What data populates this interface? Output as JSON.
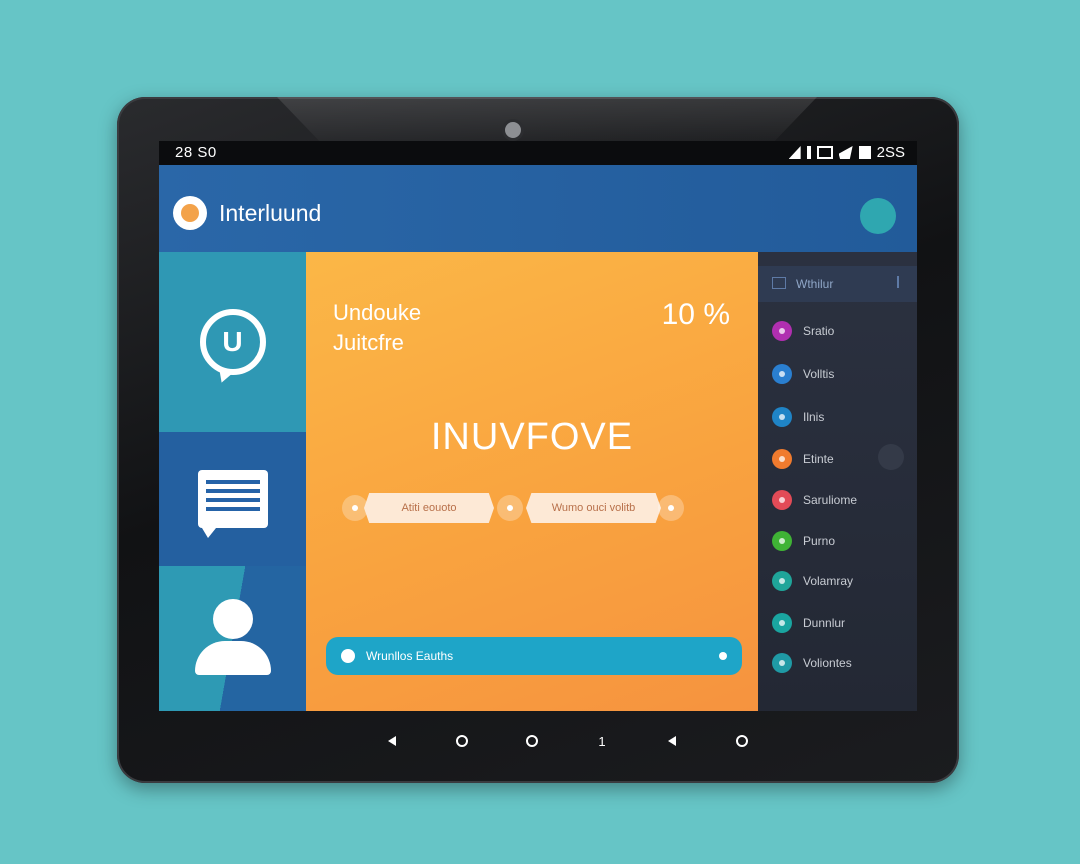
{
  "status_bar": {
    "time": "28 S0",
    "right_text": "2SS"
  },
  "app_bar": {
    "title": "Interluund"
  },
  "left_nav": {
    "tile_1_letter": "U"
  },
  "main_panel": {
    "subtitle_line1": "Undouke",
    "subtitle_line2": "Juitcfre",
    "percent": "10 %",
    "heading": "INUVFOVE",
    "pill_1_label": "Atiti    eouoto",
    "pill_2_label": "Wumo   ouci   volitb",
    "bottom_bar_label": "Wrunllos Eauths"
  },
  "right_nav": {
    "header_label": "Wthilur",
    "items": [
      {
        "label": "Sratio",
        "color": "#b02fb0"
      },
      {
        "label": "Volltis",
        "color": "#2a7fd0"
      },
      {
        "label": "Ilnis",
        "color": "#1f84c6"
      },
      {
        "label": "Etinte",
        "color": "#f07b2e"
      },
      {
        "label": "Saruliome",
        "color": "#e24b57"
      },
      {
        "label": "Purno",
        "color": "#3fb335"
      },
      {
        "label": "Volamray",
        "color": "#1fa59a"
      },
      {
        "label": "Dunnlur",
        "color": "#1aa5a0"
      },
      {
        "label": "Voliontes",
        "color": "#1f9aa5"
      }
    ]
  },
  "system_nav": {
    "middle_label": "1"
  }
}
